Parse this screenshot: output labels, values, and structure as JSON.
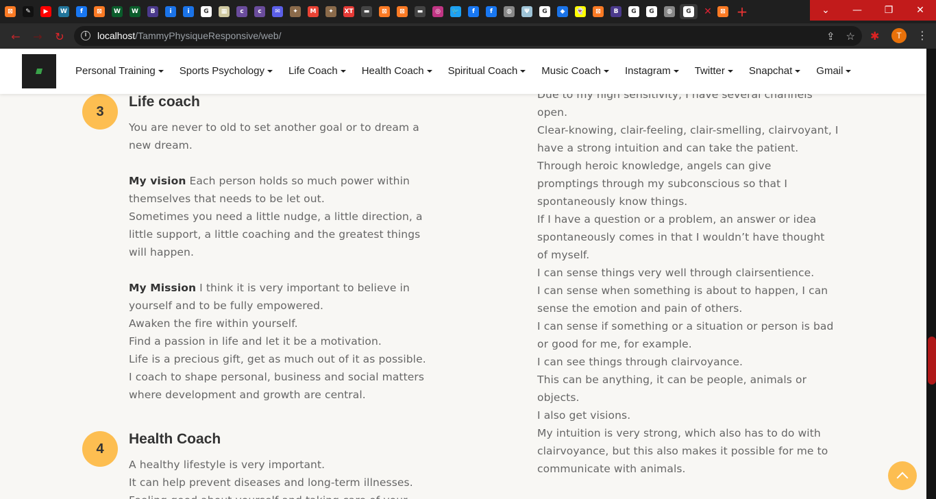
{
  "browser": {
    "tabs": [
      {
        "icon": "xampp-icon",
        "label": "",
        "color": "#fb7a24",
        "glyph": "⊠"
      },
      {
        "icon": "leaf-icon",
        "label": "",
        "color": "#111111",
        "glyph": "✎"
      },
      {
        "icon": "youtube-icon",
        "label": "",
        "color": "#ff0000",
        "glyph": "▶"
      },
      {
        "icon": "wordpress-icon",
        "label": "",
        "color": "#21759b",
        "glyph": "W"
      },
      {
        "icon": "facebook-icon",
        "label": "",
        "color": "#1877f2",
        "glyph": "f"
      },
      {
        "icon": "xampp-icon",
        "label": "",
        "color": "#fb7a24",
        "glyph": "⊠"
      },
      {
        "icon": "w-green-icon",
        "label": "",
        "color": "#0a5c2b",
        "glyph": "W"
      },
      {
        "icon": "w-green-icon",
        "label": "",
        "color": "#0a5c2b",
        "glyph": "W"
      },
      {
        "icon": "b-icon",
        "label": "",
        "color": "#4b3a8c",
        "glyph": "B"
      },
      {
        "icon": "info-icon",
        "label": "",
        "color": "#1a73e8",
        "glyph": "i"
      },
      {
        "icon": "info-icon",
        "label": "",
        "color": "#1a73e8",
        "glyph": "i"
      },
      {
        "icon": "google-icon",
        "label": "",
        "color": "#ffffff",
        "glyph": "G"
      },
      {
        "icon": "image-icon",
        "label": "",
        "color": "#cfc8a0",
        "glyph": "▦"
      },
      {
        "icon": "colorlib-icon",
        "label": "",
        "color": "#6a4c9c",
        "glyph": "c"
      },
      {
        "icon": "colorlib-icon",
        "label": "",
        "color": "#6a4c9c",
        "glyph": "c"
      },
      {
        "icon": "mail-icon",
        "label": "",
        "color": "#5b5fe8",
        "glyph": "✉"
      },
      {
        "icon": "bird-icon",
        "label": "",
        "color": "#8a6a4a",
        "glyph": "✦"
      },
      {
        "icon": "gmail-icon",
        "label": "",
        "color": "#ea4335",
        "glyph": "M"
      },
      {
        "icon": "bird-icon",
        "label": "",
        "color": "#8a6a4a",
        "glyph": "✦"
      },
      {
        "icon": "xt-icon",
        "label": "",
        "color": "#e53935",
        "glyph": "XT"
      },
      {
        "icon": "dark-tab-icon",
        "label": "",
        "color": "#444444",
        "glyph": "▬"
      },
      {
        "icon": "xampp-icon",
        "label": "",
        "color": "#fb7a24",
        "glyph": "⊠"
      },
      {
        "icon": "xampp-icon",
        "label": "",
        "color": "#fb7a24",
        "glyph": "⊠"
      },
      {
        "icon": "dark-tab-icon",
        "label": "",
        "color": "#444444",
        "glyph": "▬"
      },
      {
        "icon": "instagram-icon",
        "label": "",
        "color": "#c13584",
        "glyph": "◎"
      },
      {
        "icon": "twitter-icon",
        "label": "",
        "color": "#1da1f2",
        "glyph": "🐦"
      },
      {
        "icon": "facebook-icon",
        "label": "",
        "color": "#1877f2",
        "glyph": "f"
      },
      {
        "icon": "facebook-icon",
        "label": "",
        "color": "#1877f2",
        "glyph": "f"
      },
      {
        "icon": "globe-icon",
        "label": "",
        "color": "#888888",
        "glyph": "◍"
      },
      {
        "icon": "trident-icon",
        "label": "",
        "color": "#9ec3d6",
        "glyph": "Ψ"
      },
      {
        "icon": "google-icon",
        "label": "",
        "color": "#ffffff",
        "glyph": "G"
      },
      {
        "icon": "diamond-icon",
        "label": "",
        "color": "#1a73e8",
        "glyph": "◆"
      },
      {
        "icon": "snapchat-icon",
        "label": "",
        "color": "#fffc00",
        "glyph": "👻"
      },
      {
        "icon": "xampp-icon",
        "label": "",
        "color": "#fb7a24",
        "glyph": "⊠"
      },
      {
        "icon": "b-icon",
        "label": "",
        "color": "#4b3a8c",
        "glyph": "B"
      },
      {
        "icon": "google-icon",
        "label": "",
        "color": "#ffffff",
        "glyph": "G"
      },
      {
        "icon": "google-icon",
        "label": "",
        "color": "#ffffff",
        "glyph": "G"
      },
      {
        "icon": "globe-icon",
        "label": "",
        "color": "#888888",
        "glyph": "◍"
      },
      {
        "icon": "google-icon",
        "label": "",
        "color": "#ffffff",
        "glyph": "G",
        "active": true
      },
      {
        "icon": "xampp-icon",
        "label": "",
        "color": "#fb7a24",
        "glyph": "⊠"
      }
    ],
    "url_host": "localhost",
    "url_path": "/TammyPhysiqueResponsive/web/",
    "profile_initial": "T"
  },
  "nav": {
    "items": [
      {
        "label": "Personal Training",
        "name": "nav-personal-training"
      },
      {
        "label": "Sports Psychology",
        "name": "nav-sports-psychology"
      },
      {
        "label": "Life Coach",
        "name": "nav-life-coach"
      },
      {
        "label": "Health Coach",
        "name": "nav-health-coach"
      },
      {
        "label": "Spiritual Coach",
        "name": "nav-spiritual-coach"
      },
      {
        "label": "Music Coach",
        "name": "nav-music-coach"
      },
      {
        "label": "Instagram",
        "name": "nav-instagram"
      },
      {
        "label": "Twitter",
        "name": "nav-twitter"
      },
      {
        "label": "Snapchat",
        "name": "nav-snapchat"
      },
      {
        "label": "Gmail",
        "name": "nav-gmail"
      }
    ]
  },
  "colors": {
    "accent": "#fdbe51",
    "heading": "#333333",
    "body_text": "#666666",
    "background": "#f8f7f4"
  },
  "life_coach": {
    "number": "3",
    "title": "Life coach",
    "intro": [
      "You are never to old to set another goal or to dream a",
      "new dream."
    ],
    "vision_label": "My vision",
    "vision_first": " Each person holds so much power within",
    "vision_lines": [
      "themselves that needs to be let out.",
      "Sometimes you need a little nudge, a little direction, a",
      "little support, a little coaching and the greatest things",
      "will happen."
    ],
    "mission_label": "My Mission",
    "mission_first": " I think it is very important to believe in",
    "mission_lines": [
      "yourself and to be fully empowered.",
      "Awaken the fire within yourself.",
      "Find a passion in life and let it be a motivation.",
      "Life is a precious gift, get as much out of it as possible.",
      "I coach to shape personal, business and social matters",
      "where development and growth are central."
    ]
  },
  "health_coach": {
    "number": "4",
    "title": "Health Coach",
    "lines": [
      "A healthy lifestyle is very important.",
      "It can help prevent diseases and long-term illnesses.",
      "Feeling good about yourself and taking care of your"
    ]
  },
  "right_column": {
    "lines": [
      "Due to my high sensitivity, I have several channels",
      "open.",
      "Clear-knowing, clair-feeling, clair-smelling, clairvoyant, I",
      "have a strong intuition and can take the patient.",
      "Through heroic knowledge, angels can give",
      "promptings through my subconscious so that I",
      "spontaneously know things.",
      "If I have a question or a problem, an answer or idea",
      "spontaneously comes in that I wouldn’t have thought",
      "of myself.",
      "I can sense things very well through clairsentience.",
      "I can sense when something is about to happen, I can",
      "sense the emotion and pain of others.",
      "I can sense if something or a situation or person is bad",
      "or good for me, for example.",
      "I can see things through clairvoyance.",
      "This can be anything, it can be people, animals or",
      "objects.",
      "I also get visions.",
      "My intuition is very strong, which also has to do with",
      "clairvoyance, but this also makes it possible for me to",
      "communicate with animals."
    ]
  }
}
